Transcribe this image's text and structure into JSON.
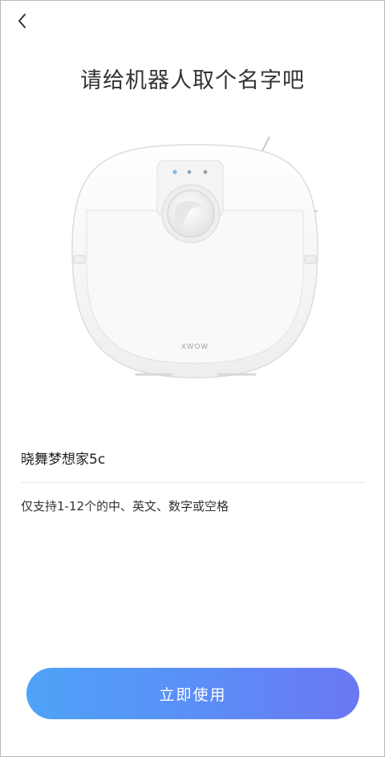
{
  "header": {
    "back_icon": "chevron-left-icon"
  },
  "page": {
    "title": "请给机器人取个名字吧"
  },
  "robot": {
    "brand": "XWOW"
  },
  "name_field": {
    "value": "晓舞梦想家5c"
  },
  "hint": {
    "text": "仅支持1-12个的中、英文、数字或空格"
  },
  "actions": {
    "confirm_label": "立即使用"
  },
  "colors": {
    "button_gradient_start": "#4ea3f7",
    "button_gradient_end": "#6b78f3",
    "title_text": "#333333",
    "divider": "#e6e6e6"
  }
}
